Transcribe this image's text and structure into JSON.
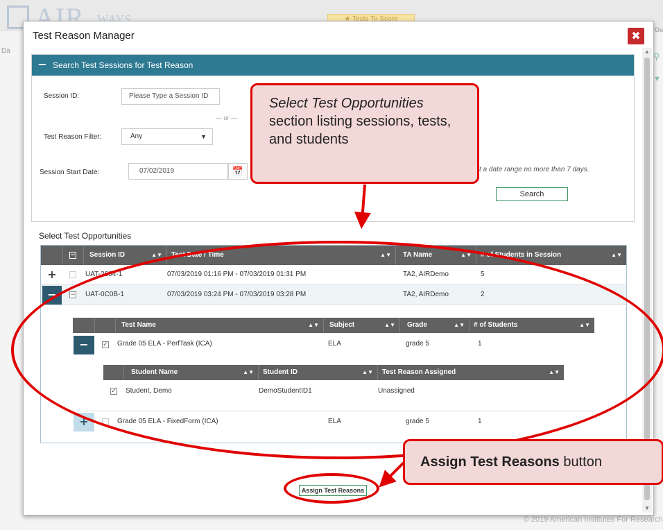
{
  "background": {
    "logo_text": "AIR",
    "logo_small": "WAYS",
    "tests_to_score_label": "★ Tests To Score",
    "left_fragment": "Da",
    "right_fragment": "Ou",
    "footer": "© 2019 American Institutes For Research"
  },
  "modal": {
    "title": "Test Reason Manager",
    "close_glyph": "✖"
  },
  "search": {
    "header_title": "Search Test Sessions for Test Reason",
    "toggle_glyph": "−",
    "session_id_label": "Session ID:",
    "session_id_placeholder": "Please Type a Session ID",
    "or_text": "— or —",
    "test_reason_filter_label": "Test Reason Filter:",
    "test_reason_filter_value": "Any",
    "session_start_date_label": "Session Start Date:",
    "session_start_date_value": "07/02/2019",
    "date_hint": "ct a date range no more than 7 days.",
    "search_button": "Search"
  },
  "select_opportunities": {
    "section_label": "Select Test Opportunities",
    "columns": [
      "Session ID",
      "Test Date / Time",
      "TA Name",
      "# of Students in Session"
    ],
    "sessions": [
      {
        "id": "UAT-2604-1",
        "datetime": "07/03/2019 01:16 PM - 07/03/2019 01:31 PM",
        "ta": "TA2, AIRDemo",
        "students": "5",
        "expanded": false
      },
      {
        "id": "UAT-0C0B-1",
        "datetime": "07/03/2019 03:24 PM - 07/03/2019 03:28 PM",
        "ta": "TA2, AIRDemo",
        "students": "2",
        "expanded": true
      }
    ],
    "test_columns": [
      "Test Name",
      "Subject",
      "Grade",
      "# of Students"
    ],
    "tests": [
      {
        "name": "Grade 05 ELA - PerfTask (ICA)",
        "subject": "ELA",
        "grade": "grade 5",
        "students": "1",
        "expanded": true,
        "checked": true
      },
      {
        "name": "Grade 05 ELA - FixedForm (ICA)",
        "subject": "ELA",
        "grade": "grade 5",
        "students": "1",
        "expanded": false,
        "checked": false
      }
    ],
    "student_columns": [
      "Student Name",
      "Student ID",
      "Test Reason Assigned"
    ],
    "students": [
      {
        "name": "Student, Demo",
        "id": "DemoStudentID1",
        "reason": "Unassigned",
        "checked": true
      }
    ]
  },
  "assign_button": "Assign Test Reasons",
  "annotations": {
    "callout_1_italic": "Select Test Opportunities",
    "callout_1_rest": "section listing sessions, tests, and students",
    "callout_2_bold": "Assign Test Reasons",
    "callout_2_rest": "button",
    "color": "#e00000"
  }
}
